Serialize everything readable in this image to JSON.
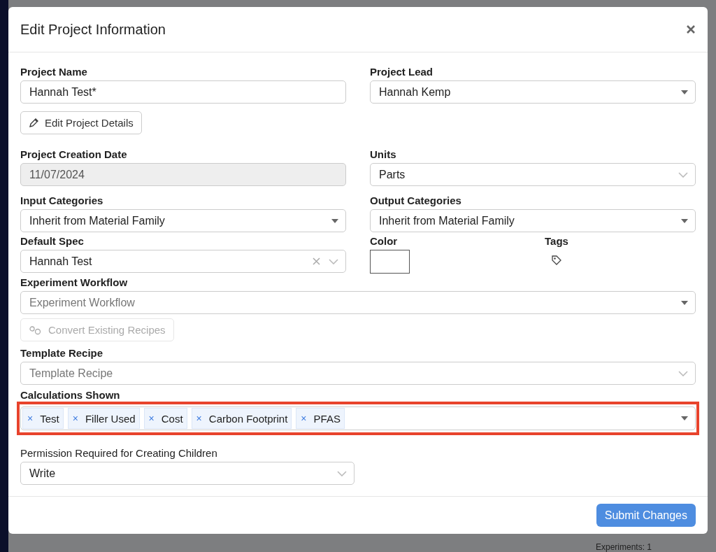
{
  "background": {
    "note": "Experiments: 1"
  },
  "dialog": {
    "title": "Edit Project Information",
    "project_name": {
      "label": "Project Name",
      "value": "Hannah Test*"
    },
    "edit_details_button": {
      "label": "Edit Project Details"
    },
    "project_lead": {
      "label": "Project Lead",
      "value": "Hannah Kemp",
      "kind": "caret"
    },
    "creation_date": {
      "label": "Project Creation Date",
      "value": "11/07/2024",
      "disabled": true
    },
    "units": {
      "label": "Units",
      "value": "Parts",
      "kind": "chevron"
    },
    "input_categories": {
      "label": "Input Categories",
      "value": "Inherit from Material Family",
      "kind": "caret"
    },
    "output_categories": {
      "label": "Output Categories",
      "value": "Inherit from Material Family",
      "kind": "caret"
    },
    "default_spec": {
      "label": "Default Spec",
      "value": "Hannah Test",
      "clearable": true,
      "kind": "chevron"
    },
    "color": {
      "label": "Color"
    },
    "tags": {
      "label": "Tags"
    },
    "experiment_workflow": {
      "label": "Experiment Workflow",
      "placeholder": "Experiment Workflow",
      "kind": "caret"
    },
    "convert_button": {
      "label": "Convert Existing Recipes",
      "disabled": true
    },
    "template_recipe": {
      "label": "Template Recipe",
      "placeholder": "Template Recipe",
      "kind": "chevron"
    },
    "calculations": {
      "label": "Calculations Shown",
      "highlighted": true,
      "kind": "caret",
      "tags": [
        {
          "remove": "×",
          "label": "Test"
        },
        {
          "remove": "×",
          "label": "Filler Used"
        },
        {
          "remove": "×",
          "label": "Cost"
        },
        {
          "remove": "×",
          "label": "Carbon Footprint"
        },
        {
          "remove": "×",
          "label": "PFAS"
        }
      ]
    },
    "permission": {
      "label": "Permission Required for Creating Children",
      "value": "Write",
      "kind": "chevron"
    },
    "submit_button": {
      "label": "Submit Changes"
    }
  }
}
